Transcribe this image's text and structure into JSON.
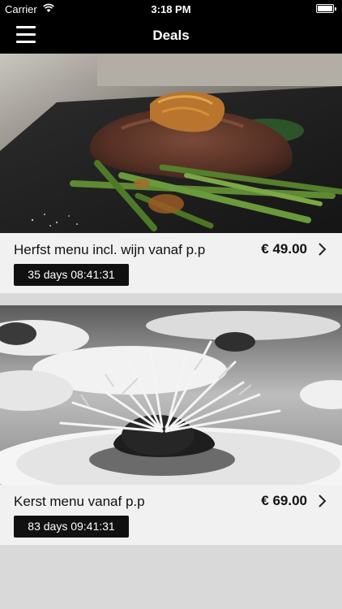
{
  "status_bar": {
    "carrier": "Carrier",
    "time": "3:18 PM"
  },
  "nav_bar": {
    "title": "Deals",
    "menu_icon": "hamburger-menu-icon"
  },
  "deals": [
    {
      "title": "Herfst menu incl. wijn vanaf p.p",
      "price": "€ 49.00",
      "countdown": "35 days 08:41:31",
      "image": "steak-with-green-beans-photo"
    },
    {
      "title": "Kerst menu vanaf p.p",
      "price": "€ 69.00",
      "countdown": "83 days 09:41:31",
      "image": "plated-dish-with-frisee-photo"
    }
  ],
  "colors": {
    "bar_background": "#000000",
    "card_footer": "#f1f1f1",
    "badge_background": "#111111",
    "page_background": "#d9d9d9"
  }
}
